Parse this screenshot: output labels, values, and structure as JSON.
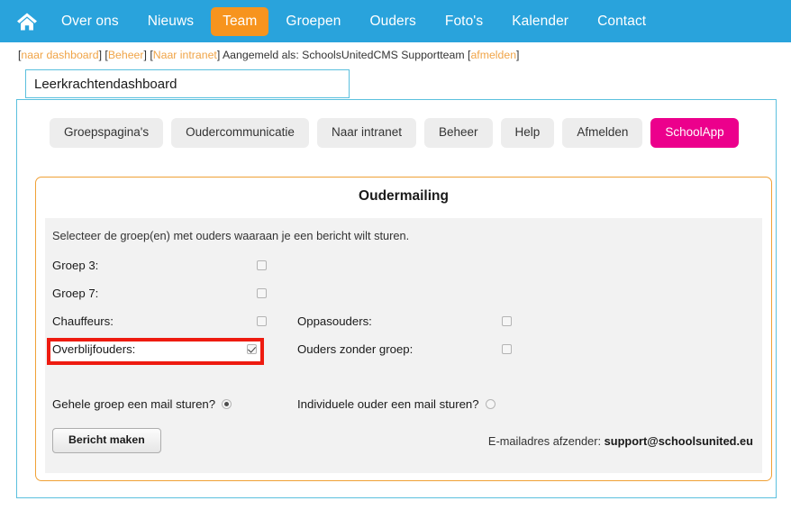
{
  "topnav": {
    "home_icon": "home-icon",
    "items": [
      {
        "label": "Over ons",
        "active": false
      },
      {
        "label": "Nieuws",
        "active": false
      },
      {
        "label": "Team",
        "active": true
      },
      {
        "label": "Groepen",
        "active": false
      },
      {
        "label": "Ouders",
        "active": false
      },
      {
        "label": "Foto's",
        "active": false
      },
      {
        "label": "Kalender",
        "active": false
      },
      {
        "label": "Contact",
        "active": false
      }
    ],
    "bar_color": "#29a3dc",
    "active_color": "#f7941e"
  },
  "crumbline": {
    "open1": "[",
    "link1": "naar dashboard",
    "close1": "] [",
    "link2": "Beheer",
    "close2": "] [",
    "link3": "Naar intranet",
    "close3": "] ",
    "text": "Aangemeld als: SchoolsUnitedCMS Supportteam ",
    "open4": "[",
    "link4": "afmelden",
    "close4": "]",
    "link_color": "#f0a447"
  },
  "page_title": {
    "value": "Leerkrachtendashboard",
    "placeholder": "Leerkrachtendashboard",
    "border_color": "#5bc0de"
  },
  "dashboard_buttons": [
    {
      "label": "Groepspagina's",
      "style": "grey"
    },
    {
      "label": "Oudercommunicatie",
      "style": "grey"
    },
    {
      "label": "Naar intranet",
      "style": "grey"
    },
    {
      "label": "Beheer",
      "style": "grey"
    },
    {
      "label": "Help",
      "style": "grey"
    },
    {
      "label": "Afmelden",
      "style": "grey"
    },
    {
      "label": "SchoolApp",
      "style": "pink"
    }
  ],
  "panel": {
    "title": "Oudermailing",
    "border_color": "#f0a136",
    "instruction": "Selecteer de groep(en) met ouders waaraan je een bericht wilt sturen.",
    "checkbox_rows": [
      {
        "col1": {
          "label": "Groep 3:",
          "checked": false,
          "highlighted": false
        },
        "col2": null
      },
      {
        "col1": {
          "label": "Groep 7:",
          "checked": false,
          "highlighted": false
        },
        "col2": null
      },
      {
        "col1": {
          "label": "Chauffeurs:",
          "checked": false,
          "highlighted": false
        },
        "col2": {
          "label": "Oppasouders:",
          "checked": false
        }
      },
      {
        "col1": {
          "label": "Overblijfouders:",
          "checked": true,
          "highlighted": true
        },
        "col2": {
          "label": "Ouders zonder groep:",
          "checked": false
        }
      }
    ],
    "highlight_color": "#ee1b10",
    "radios": {
      "left": {
        "label": "Gehele groep een mail sturen?",
        "selected": true
      },
      "right": {
        "label": "Individuele ouder een mail sturen?",
        "selected": false
      }
    },
    "submit_label": "Bericht maken",
    "sender_label": "E-mailadres afzender: ",
    "sender_email": "support@schoolsunited.eu"
  }
}
